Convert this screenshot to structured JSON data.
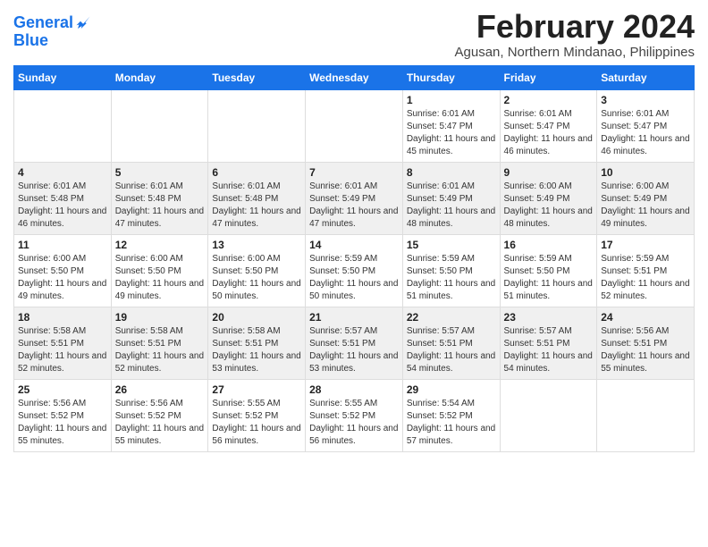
{
  "app": {
    "name_line1": "General",
    "name_line2": "Blue"
  },
  "calendar": {
    "month_year": "February 2024",
    "location": "Agusan, Northern Mindanao, Philippines",
    "days_of_week": [
      "Sunday",
      "Monday",
      "Tuesday",
      "Wednesday",
      "Thursday",
      "Friday",
      "Saturday"
    ],
    "weeks": [
      [
        {
          "day": "",
          "info": ""
        },
        {
          "day": "",
          "info": ""
        },
        {
          "day": "",
          "info": ""
        },
        {
          "day": "",
          "info": ""
        },
        {
          "day": "1",
          "info": "Sunrise: 6:01 AM\nSunset: 5:47 PM\nDaylight: 11 hours and 45 minutes."
        },
        {
          "day": "2",
          "info": "Sunrise: 6:01 AM\nSunset: 5:47 PM\nDaylight: 11 hours and 46 minutes."
        },
        {
          "day": "3",
          "info": "Sunrise: 6:01 AM\nSunset: 5:47 PM\nDaylight: 11 hours and 46 minutes."
        }
      ],
      [
        {
          "day": "4",
          "info": "Sunrise: 6:01 AM\nSunset: 5:48 PM\nDaylight: 11 hours and 46 minutes."
        },
        {
          "day": "5",
          "info": "Sunrise: 6:01 AM\nSunset: 5:48 PM\nDaylight: 11 hours and 47 minutes."
        },
        {
          "day": "6",
          "info": "Sunrise: 6:01 AM\nSunset: 5:48 PM\nDaylight: 11 hours and 47 minutes."
        },
        {
          "day": "7",
          "info": "Sunrise: 6:01 AM\nSunset: 5:49 PM\nDaylight: 11 hours and 47 minutes."
        },
        {
          "day": "8",
          "info": "Sunrise: 6:01 AM\nSunset: 5:49 PM\nDaylight: 11 hours and 48 minutes."
        },
        {
          "day": "9",
          "info": "Sunrise: 6:00 AM\nSunset: 5:49 PM\nDaylight: 11 hours and 48 minutes."
        },
        {
          "day": "10",
          "info": "Sunrise: 6:00 AM\nSunset: 5:49 PM\nDaylight: 11 hours and 49 minutes."
        }
      ],
      [
        {
          "day": "11",
          "info": "Sunrise: 6:00 AM\nSunset: 5:50 PM\nDaylight: 11 hours and 49 minutes."
        },
        {
          "day": "12",
          "info": "Sunrise: 6:00 AM\nSunset: 5:50 PM\nDaylight: 11 hours and 49 minutes."
        },
        {
          "day": "13",
          "info": "Sunrise: 6:00 AM\nSunset: 5:50 PM\nDaylight: 11 hours and 50 minutes."
        },
        {
          "day": "14",
          "info": "Sunrise: 5:59 AM\nSunset: 5:50 PM\nDaylight: 11 hours and 50 minutes."
        },
        {
          "day": "15",
          "info": "Sunrise: 5:59 AM\nSunset: 5:50 PM\nDaylight: 11 hours and 51 minutes."
        },
        {
          "day": "16",
          "info": "Sunrise: 5:59 AM\nSunset: 5:50 PM\nDaylight: 11 hours and 51 minutes."
        },
        {
          "day": "17",
          "info": "Sunrise: 5:59 AM\nSunset: 5:51 PM\nDaylight: 11 hours and 52 minutes."
        }
      ],
      [
        {
          "day": "18",
          "info": "Sunrise: 5:58 AM\nSunset: 5:51 PM\nDaylight: 11 hours and 52 minutes."
        },
        {
          "day": "19",
          "info": "Sunrise: 5:58 AM\nSunset: 5:51 PM\nDaylight: 11 hours and 52 minutes."
        },
        {
          "day": "20",
          "info": "Sunrise: 5:58 AM\nSunset: 5:51 PM\nDaylight: 11 hours and 53 minutes."
        },
        {
          "day": "21",
          "info": "Sunrise: 5:57 AM\nSunset: 5:51 PM\nDaylight: 11 hours and 53 minutes."
        },
        {
          "day": "22",
          "info": "Sunrise: 5:57 AM\nSunset: 5:51 PM\nDaylight: 11 hours and 54 minutes."
        },
        {
          "day": "23",
          "info": "Sunrise: 5:57 AM\nSunset: 5:51 PM\nDaylight: 11 hours and 54 minutes."
        },
        {
          "day": "24",
          "info": "Sunrise: 5:56 AM\nSunset: 5:51 PM\nDaylight: 11 hours and 55 minutes."
        }
      ],
      [
        {
          "day": "25",
          "info": "Sunrise: 5:56 AM\nSunset: 5:52 PM\nDaylight: 11 hours and 55 minutes."
        },
        {
          "day": "26",
          "info": "Sunrise: 5:56 AM\nSunset: 5:52 PM\nDaylight: 11 hours and 55 minutes."
        },
        {
          "day": "27",
          "info": "Sunrise: 5:55 AM\nSunset: 5:52 PM\nDaylight: 11 hours and 56 minutes."
        },
        {
          "day": "28",
          "info": "Sunrise: 5:55 AM\nSunset: 5:52 PM\nDaylight: 11 hours and 56 minutes."
        },
        {
          "day": "29",
          "info": "Sunrise: 5:54 AM\nSunset: 5:52 PM\nDaylight: 11 hours and 57 minutes."
        },
        {
          "day": "",
          "info": ""
        },
        {
          "day": "",
          "info": ""
        }
      ]
    ]
  }
}
